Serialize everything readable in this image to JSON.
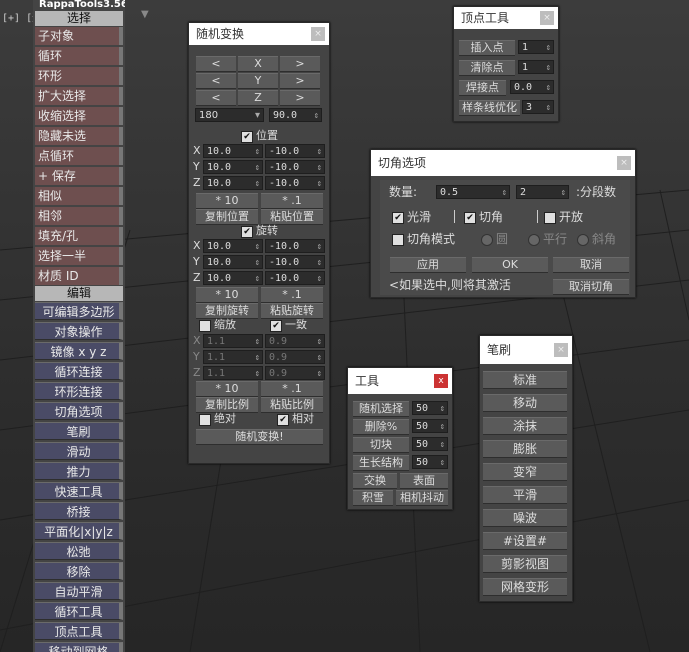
{
  "viewport": {
    "label": "[+] [透",
    "filter_icon": "filter-icon"
  },
  "rappa": {
    "title": "RappaTools3.56",
    "select_header": "选择",
    "select_items": [
      "子对象",
      "循环",
      "环形",
      "扩大选择",
      "收缩选择",
      "隐藏未选",
      "点循环",
      "+ 保存",
      "相似",
      "相邻",
      "填充/孔",
      "选择一半",
      "材质 ID"
    ],
    "edit_header": "编辑",
    "edit_items": [
      "可编辑多边形",
      "对象操作",
      "镜像  x y z",
      "循环连接",
      "环形连接",
      "切角选项",
      "笔刷",
      "滑动",
      "推力",
      "快速工具",
      "桥接",
      "平面化|x|y|z",
      "松弛",
      "移除",
      "自动平滑",
      "循环工具",
      "顶点工具",
      "移动到网格"
    ]
  },
  "random": {
    "title": "随机变换",
    "arrow_left": "<",
    "arrow_right": ">",
    "axis_x": "X",
    "axis_y": "Y",
    "axis_z": "Z",
    "angle_combo": "180",
    "angle_value": "90.0",
    "position_label": "位置",
    "rotation_label": "旋转",
    "scale_label": "缩放",
    "uniform_label": "一致",
    "pos": {
      "x1": "10.0",
      "x2": "-10.0",
      "y1": "10.0",
      "y2": "-10.0",
      "z1": "10.0",
      "z2": "-10.0"
    },
    "rot": {
      "x1": "10.0",
      "x2": "-10.0",
      "y1": "10.0",
      "y2": "-10.0",
      "z1": "10.0",
      "z2": "-10.0"
    },
    "scl": {
      "x1": "1.1",
      "x2": "0.9",
      "y1": "1.1",
      "y2": "0.9",
      "z1": "1.1",
      "z2": "0.9"
    },
    "mul10": "* 10",
    "mul01": "* .1",
    "copy_pos": "复制位置",
    "paste_pos": "粘贴位置",
    "copy_rot": "复制旋转",
    "paste_rot": "粘贴旋转",
    "copy_scl": "复制比例",
    "paste_scl": "粘贴比例",
    "absolute": "绝对",
    "relative": "相对",
    "apply": "随机变换!"
  },
  "vertex": {
    "title": "顶点工具",
    "insert": "插入点",
    "insert_val": "1",
    "clear": "清除点",
    "clear_val": "1",
    "weld": "焊接点",
    "weld_val": "0.0",
    "spline": "样条线优化",
    "spline_val": "3"
  },
  "chamfer": {
    "title": "切角选项",
    "amount_label": "数量:",
    "amount": "0.5",
    "segments": "2",
    "segments_label": ":分段数",
    "smooth": "光滑",
    "chamfer": "切角",
    "open": "开放",
    "mode": "切角模式",
    "round": "圆",
    "parallel": "平行",
    "bevel": "斜角",
    "apply": "应用",
    "ok": "OK",
    "cancel": "取消",
    "hint": "<如果选中,则将其激活",
    "cancel_chamfer": "取消切角"
  },
  "tools": {
    "title": "工具",
    "close": "x",
    "random_select": "随机选择",
    "random_select_val": "50",
    "delete_pct": "删除%",
    "delete_pct_val": "50",
    "chunk": "切块",
    "chunk_val": "50",
    "grow": "生长结构",
    "grow_val": "50",
    "swap": "交换",
    "surface": "表面",
    "snow": "积雪",
    "camera_shake": "相机抖动"
  },
  "brush": {
    "title": "笔刷",
    "items": [
      "标准",
      "移动",
      "涂抹",
      "膨胀",
      "变窄",
      "平滑",
      "噪波",
      "#设置#",
      "剪影视图",
      "网格变形"
    ]
  }
}
